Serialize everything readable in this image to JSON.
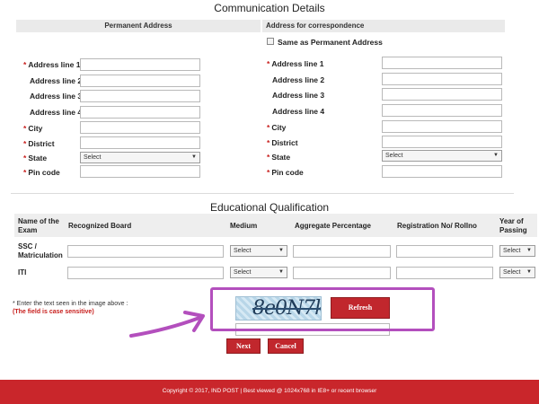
{
  "communication": {
    "title": "Communication Details",
    "permanent_header": "Permanent Address",
    "correspondence_header": "Address for correspondence",
    "same_as_label": "Same as Permanent Address",
    "labels": {
      "address1": "Address line 1",
      "address2": "Address line 2",
      "address3": "Address line 3",
      "address4": "Address line 4",
      "city": "City",
      "district": "District",
      "state": "State",
      "pincode": "Pin code"
    },
    "required_marker": "*",
    "state_select": "Select"
  },
  "education": {
    "title": "Educational Qualification",
    "columns": {
      "name_of_exam": "Name of the Exam",
      "board": "Recognized Board",
      "medium": "Medium",
      "percentage": "Aggregate Percentage",
      "regno": "Registration No/ Rollno",
      "year": "Year of Passing"
    },
    "rows": [
      {
        "name": "SSC / Matriculation",
        "medium_select": "Select",
        "year_select": "Select"
      },
      {
        "name": "ITI",
        "medium_select": "Select",
        "year_select": "Select"
      }
    ]
  },
  "captcha": {
    "instruction": "* Enter the text seen in the image above :",
    "note": "(The field is case sensitive)",
    "image_text": "8e0N7k",
    "refresh_label": "Refresh"
  },
  "actions": {
    "next_label": "Next",
    "cancel_label": "Cancel"
  },
  "footer": {
    "text": "Copyright © 2017, IND POST | Best viewed @ 1024x768 in IE8+ or recent browser"
  },
  "colors": {
    "accent_red": "#c1272d",
    "annotation_purple": "#b34fbd"
  },
  "annotation": {
    "icon": "arrow-icon"
  }
}
